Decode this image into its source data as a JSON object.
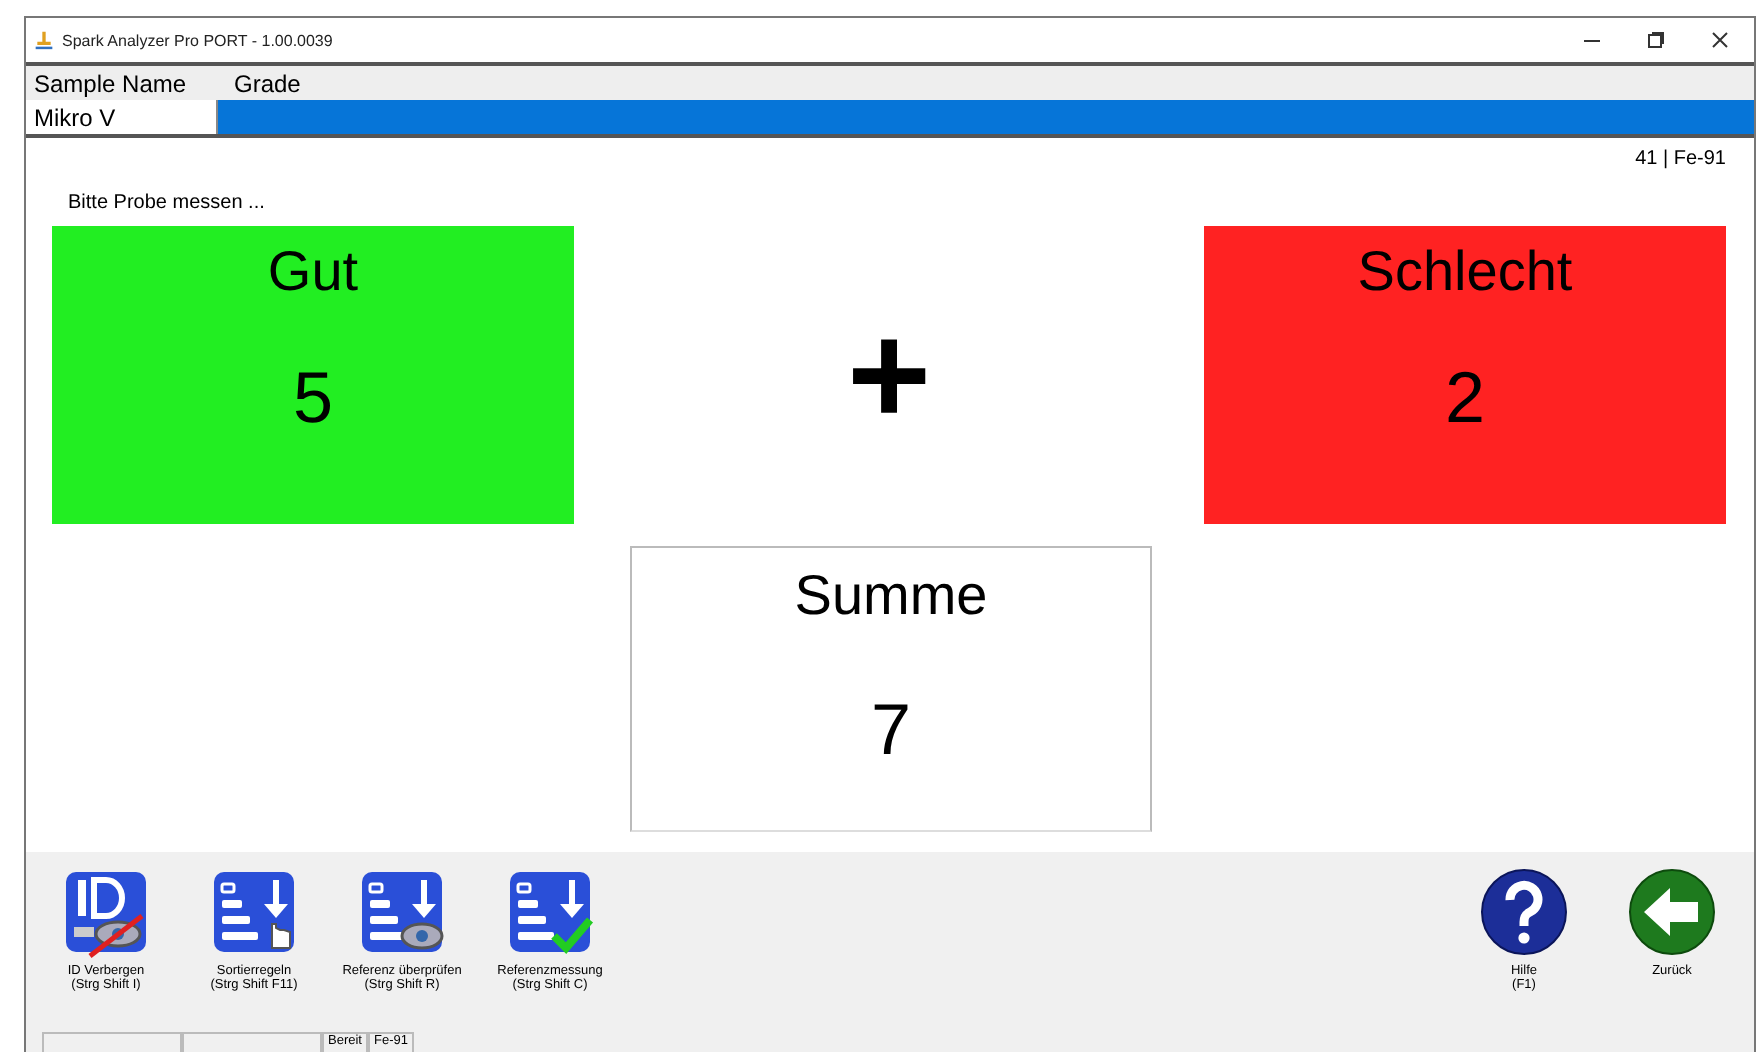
{
  "window": {
    "title": "Spark Analyzer Pro PORT - 1.00.0039"
  },
  "sample_table": {
    "columns": [
      "Sample Name",
      "Grade"
    ],
    "row": [
      "Mikro V"
    ],
    "grade_selected": true
  },
  "reference": "41 | Fe-91",
  "prompt": "Bitte Probe messen ...",
  "counters": [
    {
      "label": "Gut",
      "value": "5",
      "color": "#22ee22"
    },
    {
      "label": "Schlecht",
      "value": "2",
      "color": "#ff2222"
    }
  ],
  "operator": "+",
  "total": {
    "label": "Summe",
    "value": "7",
    "color": "#ffffff"
  },
  "toolbar_left": [
    {
      "kind": "hide-id",
      "line1": "ID Verbergen",
      "line2": "(Strg Shift I)"
    },
    {
      "kind": "sort",
      "line1": "Sortierregeln",
      "line2": "(Strg Shift F11)"
    },
    {
      "kind": "check",
      "line1": "Referenz überprüfen",
      "line2": "(Strg Shift R)"
    },
    {
      "kind": "measure",
      "line1": "Referenzmessung",
      "line2": "(Strg Shift C)"
    }
  ],
  "toolbar_right": [
    {
      "kind": "help",
      "line1": "Hilfe",
      "line2": "(F1)"
    },
    {
      "kind": "back",
      "line1": "Zurück"
    }
  ],
  "status_bar": [
    "Bereit",
    "Fe-91"
  ]
}
